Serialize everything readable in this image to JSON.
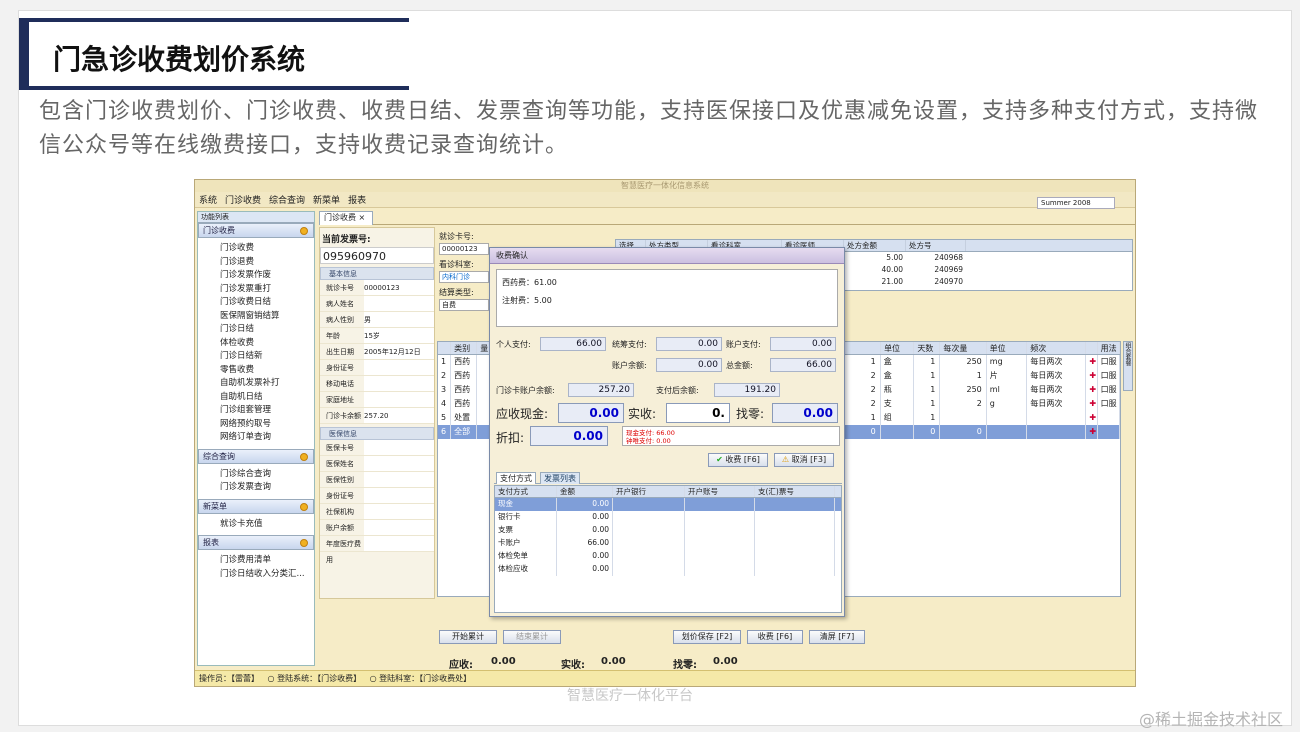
{
  "slide": {
    "title": "门急诊收费划价系统",
    "description": "包含门诊收费划价、门诊收费、收费日结、发票查询等功能，支持医保接口及优惠减免设置，支持多种支付方式，支持微信公众号等在线缴费接口，支持收费记录查询统计。",
    "caption": "智慧医疗一体化平台",
    "watermark": "@稀土掘金技术社区"
  },
  "app": {
    "window_title": "智慧医疗一体化信息系统",
    "menu": [
      "系统",
      "门诊收费",
      "综合查询",
      "新菜单",
      "报表"
    ],
    "user": "Summer 2008",
    "tab": "门诊收费 ×",
    "sidebar": {
      "header": "功能列表",
      "groups": [
        {
          "label": "门诊收费",
          "items": [
            "门诊收费",
            "门诊退费",
            "门诊发票作废",
            "门诊发票重打",
            "门诊收费日结",
            "医保隔窗销结算",
            "门诊日结",
            "体检收费",
            "门诊日结新",
            "零售收费",
            "自助机发票补打",
            "自助机日结",
            "门诊组套管理",
            "网络预约取号",
            "网络订单查询"
          ]
        },
        {
          "label": "综合查询",
          "items": [
            "门诊综合查询",
            "门诊发票查询"
          ]
        },
        {
          "label": "新菜单",
          "items": [
            "就诊卡充值"
          ]
        },
        {
          "label": "报表",
          "items": [
            "门诊费用清单",
            "门诊日结收入分类汇..."
          ]
        }
      ]
    },
    "invoice": {
      "label": "当前发票号:",
      "number": "095960970",
      "basic_header": "基本信息",
      "basic": [
        {
          "k": "就诊卡号",
          "v": "00000123"
        },
        {
          "k": "病人姓名",
          "v": ""
        },
        {
          "k": "病人性别",
          "v": "男"
        },
        {
          "k": "年龄",
          "v": "15岁"
        },
        {
          "k": "出生日期",
          "v": "2005年12月12日"
        },
        {
          "k": "身份证号",
          "v": ""
        },
        {
          "k": "移动电话",
          "v": ""
        },
        {
          "k": "家庭地址",
          "v": ""
        },
        {
          "k": "门诊卡余额",
          "v": "257.20"
        }
      ],
      "insurance_header": "医保信息",
      "insurance": [
        "医保卡号",
        "医保姓名",
        "医保性别",
        "身份证号",
        "社保机构",
        "账户余额",
        "年度医疗费用"
      ]
    },
    "visit": {
      "card_label": "就诊卡号:",
      "card_value": "00000123",
      "dept_label": "看诊科室:",
      "dept_value": "内科门诊",
      "settle_label": "结算类型:",
      "settle_value": "自费"
    },
    "rx_table": {
      "headers": [
        "选择",
        "处方类型",
        "看诊科室",
        "看诊医师",
        "处方金额",
        "处方号"
      ],
      "rows": [
        [
          "",
          "",
          "",
          "",
          "5.00",
          "240968"
        ],
        [
          "",
          "",
          "",
          "",
          "40.00",
          "240969"
        ],
        [
          "",
          "",
          "",
          "",
          "21.00",
          "240970"
        ]
      ]
    },
    "drug_table": {
      "headers": [
        "",
        "类别",
        "量",
        "单位",
        "天数",
        "每次量",
        "单位",
        "频次",
        "",
        "用法"
      ],
      "rows": [
        [
          "1",
          "西药",
          "1",
          "盒",
          "1",
          "250",
          "mg",
          "每日两次",
          "✚",
          "口服"
        ],
        [
          "2",
          "西药",
          "2",
          "盒",
          "1",
          "1",
          "片",
          "每日两次",
          "✚",
          "口服"
        ],
        [
          "3",
          "西药",
          "2",
          "瓶",
          "1",
          "250",
          "ml",
          "每日两次",
          "✚",
          "口服"
        ],
        [
          "4",
          "西药",
          "2",
          "支",
          "1",
          "2",
          "g",
          "每日两次",
          "✚",
          "口服"
        ],
        [
          "5",
          "处置",
          "1",
          "组",
          "1",
          "",
          "",
          "",
          "✚",
          ""
        ],
        [
          "6",
          "全部",
          "0",
          "",
          "0",
          "0",
          "",
          "",
          "✚",
          ""
        ]
      ],
      "side_tab": "组合套餐"
    },
    "dialog": {
      "title": "收费确认",
      "fees": [
        "西药费：61.00",
        "注射费：5.00"
      ],
      "personal_pay_label": "个人支付:",
      "personal_pay": "66.00",
      "pool_pay_label": "统筹支付:",
      "pool_pay": "0.00",
      "account_pay_label": "账户支付:",
      "account_pay": "0.00",
      "account_balance_label": "账户余额:",
      "account_balance": "0.00",
      "total_label": "总金额:",
      "total": "66.00",
      "card_balance_label": "门诊卡账户余额:",
      "card_balance": "257.20",
      "after_balance_label": "支付后余额:",
      "after_balance": "191.20",
      "due_label": "应收现金:",
      "due": "0.00",
      "received_label": "实收:",
      "received": "0.",
      "change_label": "找零:",
      "change": "0.00",
      "discount_label": "折扣:",
      "discount": "0.00",
      "note_lines": [
        "现金支付: 66.00",
        "钟唯支付: 0.00"
      ],
      "charge_btn": "收费 [F6]",
      "cancel_btn": "取消 [F3]",
      "pay_tabs": [
        "支付方式",
        "发票列表"
      ],
      "pay_headers": [
        "支付方式",
        "金额",
        "开户银行",
        "开户账号",
        "支(汇)票号"
      ],
      "pay_rows": [
        [
          "现金",
          "0.00"
        ],
        [
          "银行卡",
          "0.00"
        ],
        [
          "支票",
          "0.00"
        ],
        [
          "卡账户",
          "66.00"
        ],
        [
          "体检免单",
          "0.00"
        ],
        [
          "体检应收",
          "0.00"
        ]
      ]
    },
    "bottom": {
      "start_btn": "开始累计",
      "end_btn": "结束累计",
      "save_btn": "划价保存 [F2]",
      "charge_btn": "收费 [F6]",
      "clear_btn": "清屏 [F7]",
      "due_label": "应收:",
      "due": "0.00",
      "paid_label": "实收:",
      "paid": "0.00",
      "change_label": "找零:",
      "change": "0.00"
    },
    "status": [
      "操作员：【雷蕾】",
      "○ 登陆系统：【门诊收费】",
      "○ 登陆科室：【门诊收费处】"
    ]
  }
}
